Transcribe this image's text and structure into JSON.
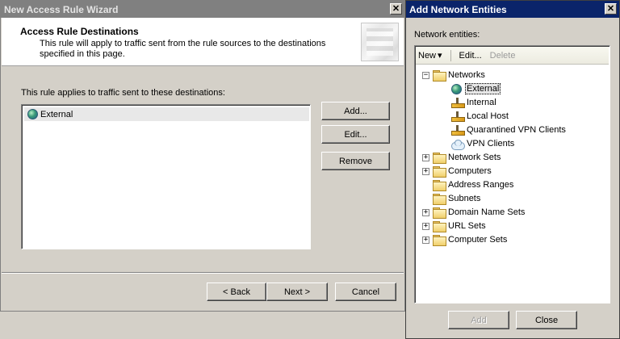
{
  "wizard": {
    "title": "New Access Rule Wizard",
    "close_glyph": "✕",
    "header_title": "Access Rule Destinations",
    "header_subtitle": "This rule will apply to traffic sent from the rule sources to the destinations specified in this page.",
    "applies_label": "This rule applies to traffic sent to these destinations:",
    "destinations": [
      {
        "label": "External",
        "icon": "globe-icon"
      }
    ],
    "buttons": {
      "add": "Add...",
      "edit": "Edit...",
      "remove": "Remove",
      "back": "< Back",
      "next": "Next >",
      "cancel": "Cancel"
    }
  },
  "entities": {
    "title": "Add Network Entities",
    "close_glyph": "✕",
    "label": "Network entities:",
    "toolbar": {
      "new": "New",
      "new_arrow": "▾",
      "edit": "Edit...",
      "delete": "Delete"
    },
    "tree": {
      "root": {
        "label": "Networks",
        "expander": "−"
      },
      "networks": [
        {
          "label": "External",
          "icon": "globe-icon",
          "selected": true
        },
        {
          "label": "Internal",
          "icon": "network-icon"
        },
        {
          "label": "Local Host",
          "icon": "network-icon"
        },
        {
          "label": "Quarantined VPN Clients",
          "icon": "network-icon"
        },
        {
          "label": "VPN Clients",
          "icon": "cloud-icon"
        }
      ],
      "folders": [
        {
          "label": "Network Sets",
          "expander": "+"
        },
        {
          "label": "Computers",
          "expander": "+"
        },
        {
          "label": "Address Ranges",
          "expander": ""
        },
        {
          "label": "Subnets",
          "expander": ""
        },
        {
          "label": "Domain Name Sets",
          "expander": "+"
        },
        {
          "label": "URL Sets",
          "expander": "+"
        },
        {
          "label": "Computer Sets",
          "expander": "+"
        }
      ]
    },
    "buttons": {
      "add": "Add",
      "close": "Close"
    }
  }
}
